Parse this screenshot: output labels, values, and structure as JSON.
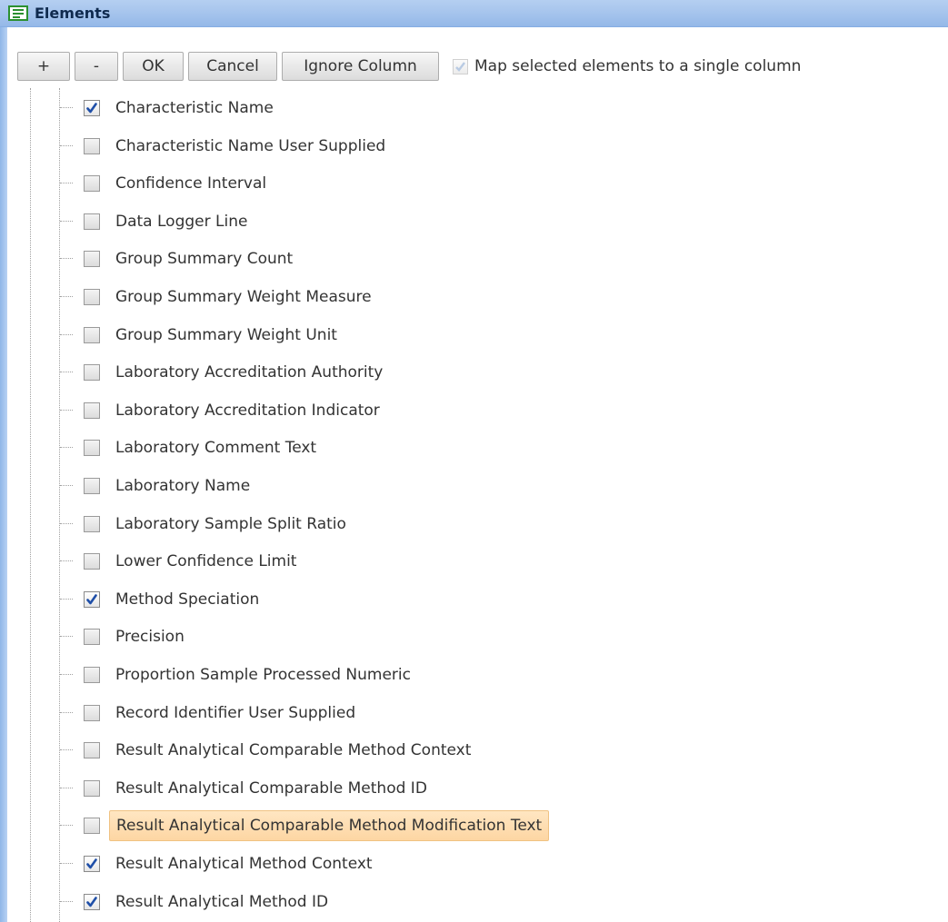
{
  "header": {
    "title": "Elements",
    "icon": "list-panel-icon",
    "background": "#a4c3ec",
    "icon_color": "#2b9030"
  },
  "toolbar": {
    "add_label": "+",
    "remove_label": "-",
    "ok_label": "OK",
    "cancel_label": "Cancel",
    "ignore_label": "Ignore Column",
    "map_single_label": "Map selected elements to a single column",
    "map_single_checked": true,
    "map_single_enabled": false
  },
  "tree": {
    "highlight_color": "#fdd6a3",
    "items": [
      {
        "label": "Characteristic Name",
        "checked": true,
        "highlighted": false
      },
      {
        "label": "Characteristic Name User Supplied",
        "checked": false,
        "highlighted": false
      },
      {
        "label": "Confidence Interval",
        "checked": false,
        "highlighted": false
      },
      {
        "label": "Data Logger Line",
        "checked": false,
        "highlighted": false
      },
      {
        "label": "Group Summary Count",
        "checked": false,
        "highlighted": false
      },
      {
        "label": "Group Summary Weight Measure",
        "checked": false,
        "highlighted": false
      },
      {
        "label": "Group Summary Weight Unit",
        "checked": false,
        "highlighted": false
      },
      {
        "label": "Laboratory Accreditation Authority",
        "checked": false,
        "highlighted": false
      },
      {
        "label": "Laboratory Accreditation Indicator",
        "checked": false,
        "highlighted": false
      },
      {
        "label": "Laboratory Comment Text",
        "checked": false,
        "highlighted": false
      },
      {
        "label": "Laboratory Name",
        "checked": false,
        "highlighted": false
      },
      {
        "label": "Laboratory Sample Split Ratio",
        "checked": false,
        "highlighted": false
      },
      {
        "label": "Lower Confidence Limit",
        "checked": false,
        "highlighted": false
      },
      {
        "label": "Method Speciation",
        "checked": true,
        "highlighted": false
      },
      {
        "label": "Precision",
        "checked": false,
        "highlighted": false
      },
      {
        "label": "Proportion Sample Processed Numeric",
        "checked": false,
        "highlighted": false
      },
      {
        "label": "Record Identifier User Supplied",
        "checked": false,
        "highlighted": false
      },
      {
        "label": "Result Analytical Comparable Method Context",
        "checked": false,
        "highlighted": false
      },
      {
        "label": "Result Analytical Comparable Method ID",
        "checked": false,
        "highlighted": false
      },
      {
        "label": "Result Analytical Comparable Method Modification Text",
        "checked": false,
        "highlighted": true
      },
      {
        "label": "Result Analytical Method Context",
        "checked": true,
        "highlighted": false
      },
      {
        "label": "Result Analytical Method ID",
        "checked": true,
        "highlighted": false
      }
    ]
  }
}
